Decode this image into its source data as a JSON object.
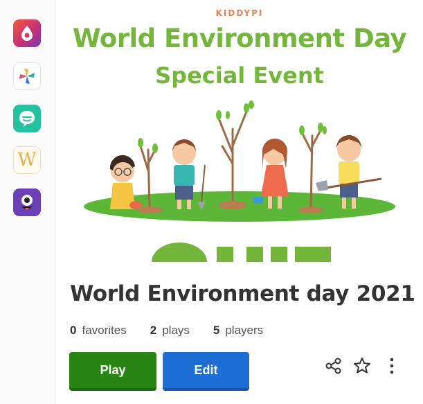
{
  "sidebar": {
    "apps": [
      {
        "icon": "droplet-app-icon",
        "color": "#e9485c"
      },
      {
        "icon": "pinwheel-app-icon",
        "color": "#ffffff"
      },
      {
        "icon": "chat-bubble-app-icon",
        "color": "#22c2a1"
      },
      {
        "icon": "w-letter-app-icon",
        "color": "#fffaf0",
        "letter": "W"
      },
      {
        "icon": "monster-app-icon",
        "color": "#6b3fb5"
      }
    ]
  },
  "banner": {
    "brand": "KIDDYPI",
    "headline_line1": "World Environment Day",
    "headline_line2": "Special Event"
  },
  "quiz": {
    "title": "World Environment day 2021",
    "stats": [
      {
        "value": "0",
        "label": "favorites"
      },
      {
        "value": "2",
        "label": "plays"
      },
      {
        "value": "5",
        "label": "players"
      }
    ],
    "play_label": "Play",
    "edit_label": "Edit"
  },
  "colors": {
    "headline_green": "#74b63b",
    "play_green": "#2a8513",
    "edit_blue": "#1c6ed4",
    "grass_green": "#5cb637"
  }
}
